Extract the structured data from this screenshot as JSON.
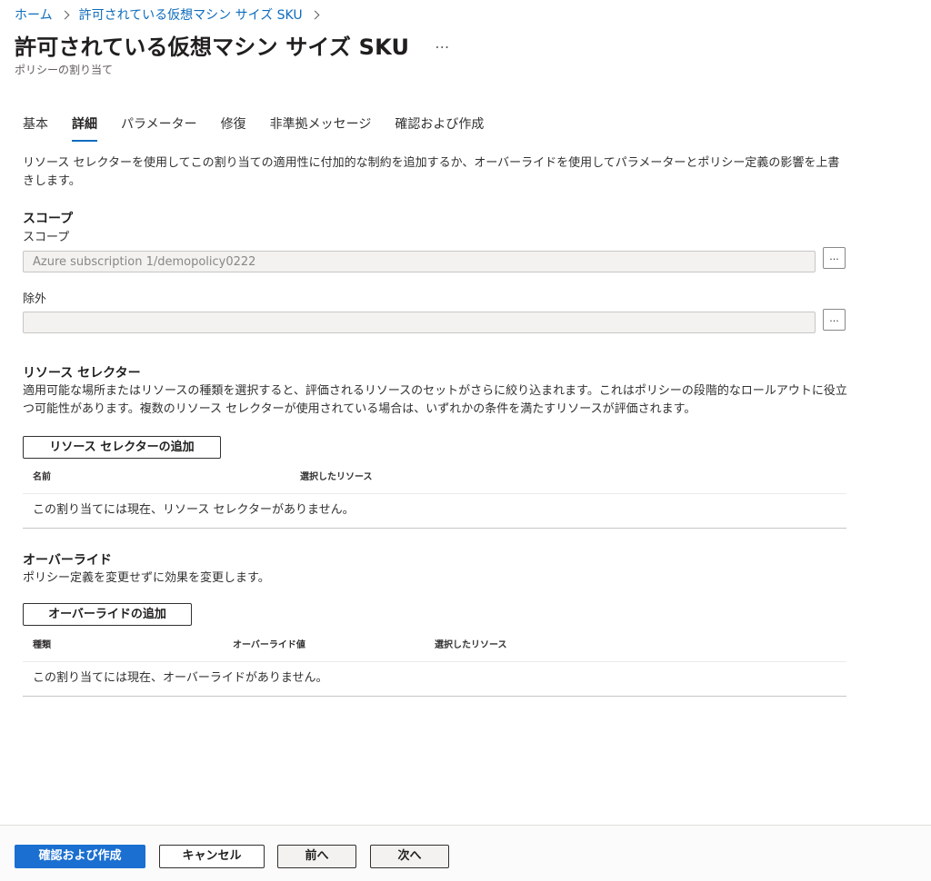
{
  "breadcrumb": {
    "home": "ホーム",
    "parent": "許可されている仮想マシン サイズ SKU"
  },
  "header": {
    "title": "許可されている仮想マシン サイズ SKU",
    "more_icon": "…",
    "subtitle": "ポリシーの割り当て"
  },
  "tabs": [
    {
      "label": "基本"
    },
    {
      "label": "詳細",
      "active": true
    },
    {
      "label": "パラメーター"
    },
    {
      "label": "修復"
    },
    {
      "label": "非準拠メッセージ"
    },
    {
      "label": "確認および作成"
    }
  ],
  "intro": "リソース セレクターを使用してこの割り当ての適用性に付加的な制約を追加するか、オーバーライドを使用してパラメーターとポリシー定義の影響を上書きします。",
  "scope": {
    "heading": "スコープ",
    "label": "スコープ",
    "value": "Azure subscription 1/demopolicy0222",
    "button": "...",
    "exclusion_label": "除外",
    "exclusion_value": "",
    "exclusion_button": "..."
  },
  "resource_selectors": {
    "heading": "リソース セレクター",
    "description": "適用可能な場所またはリソースの種類を選択すると、評価されるリソースのセットがさらに絞り込まれます。これはポリシーの段階的なロールアウトに役立つ可能性があります。複数のリソース セレクターが使用されている場合は、いずれかの条件を満たすリソースが評価されます。",
    "add_button": "リソース セレクターの追加",
    "columns": [
      "名前",
      "選択したリソース"
    ],
    "empty": "この割り当てには現在、リソース セレクターがありません。"
  },
  "overrides": {
    "heading": "オーバーライド",
    "description": "ポリシー定義を変更せずに効果を変更します。",
    "add_button": "オーバーライドの追加",
    "columns": [
      "種類",
      "オーバーライド値",
      "選択したリソース"
    ],
    "empty": "この割り当てには現在、オーバーライドがありません。"
  },
  "footer": {
    "review_create": "確認および作成",
    "cancel": "キャンセル",
    "previous": "前へ",
    "next": "次へ"
  },
  "colors": {
    "accent": "#0f6cbd",
    "primary_button": "#1a6fd0"
  }
}
